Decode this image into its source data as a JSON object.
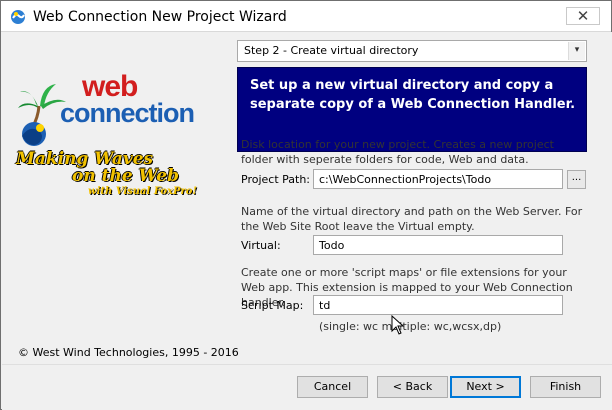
{
  "window": {
    "title": "Web Connection New Project Wizard",
    "close_glyph": "✕"
  },
  "wizard": {
    "step_select": {
      "value": "Step 2 - Create virtual directory",
      "arrow_glyph": "▾"
    },
    "banner_text": "Set up a new virtual directory and copy a separate copy of a Web Connection Handler."
  },
  "branding": {
    "logo_text_top": "web",
    "logo_text_bottom": "connection",
    "tagline_line1": "Making Waves",
    "tagline_line2": "on the Web",
    "tagline_line3": "with Visual FoxPro!",
    "copyright": "© West Wind Technologies, 1995 - 2016"
  },
  "project_path": {
    "description": "Disk location for your new project. Creates a new project folder with seperate folders for code, Web and data.",
    "label": "Project Path:",
    "value": "c:\\WebConnectionProjects\\Todo",
    "browse_label": "..."
  },
  "virtual": {
    "description": "Name of the virtual directory and path on the Web Server. For the Web Site Root leave the Virtual empty.",
    "label": "Virtual:",
    "value": "Todo"
  },
  "script_map": {
    "description": "Create one or more 'script maps' or file extensions for your Web app. This extension is mapped to your Web Connection handler.",
    "label": "Script Map:",
    "value": "td",
    "hint": "(single: wc  multiple: wc,wcsx,dp)"
  },
  "buttons": {
    "cancel": "Cancel",
    "back": "< Back",
    "next": "Next >",
    "finish": "Finish"
  },
  "colors": {
    "banner_bg": "#000080",
    "logo_red": "#d21e1e",
    "logo_blue": "#1c5fb3",
    "tagline_yellow": "#f2c200"
  }
}
